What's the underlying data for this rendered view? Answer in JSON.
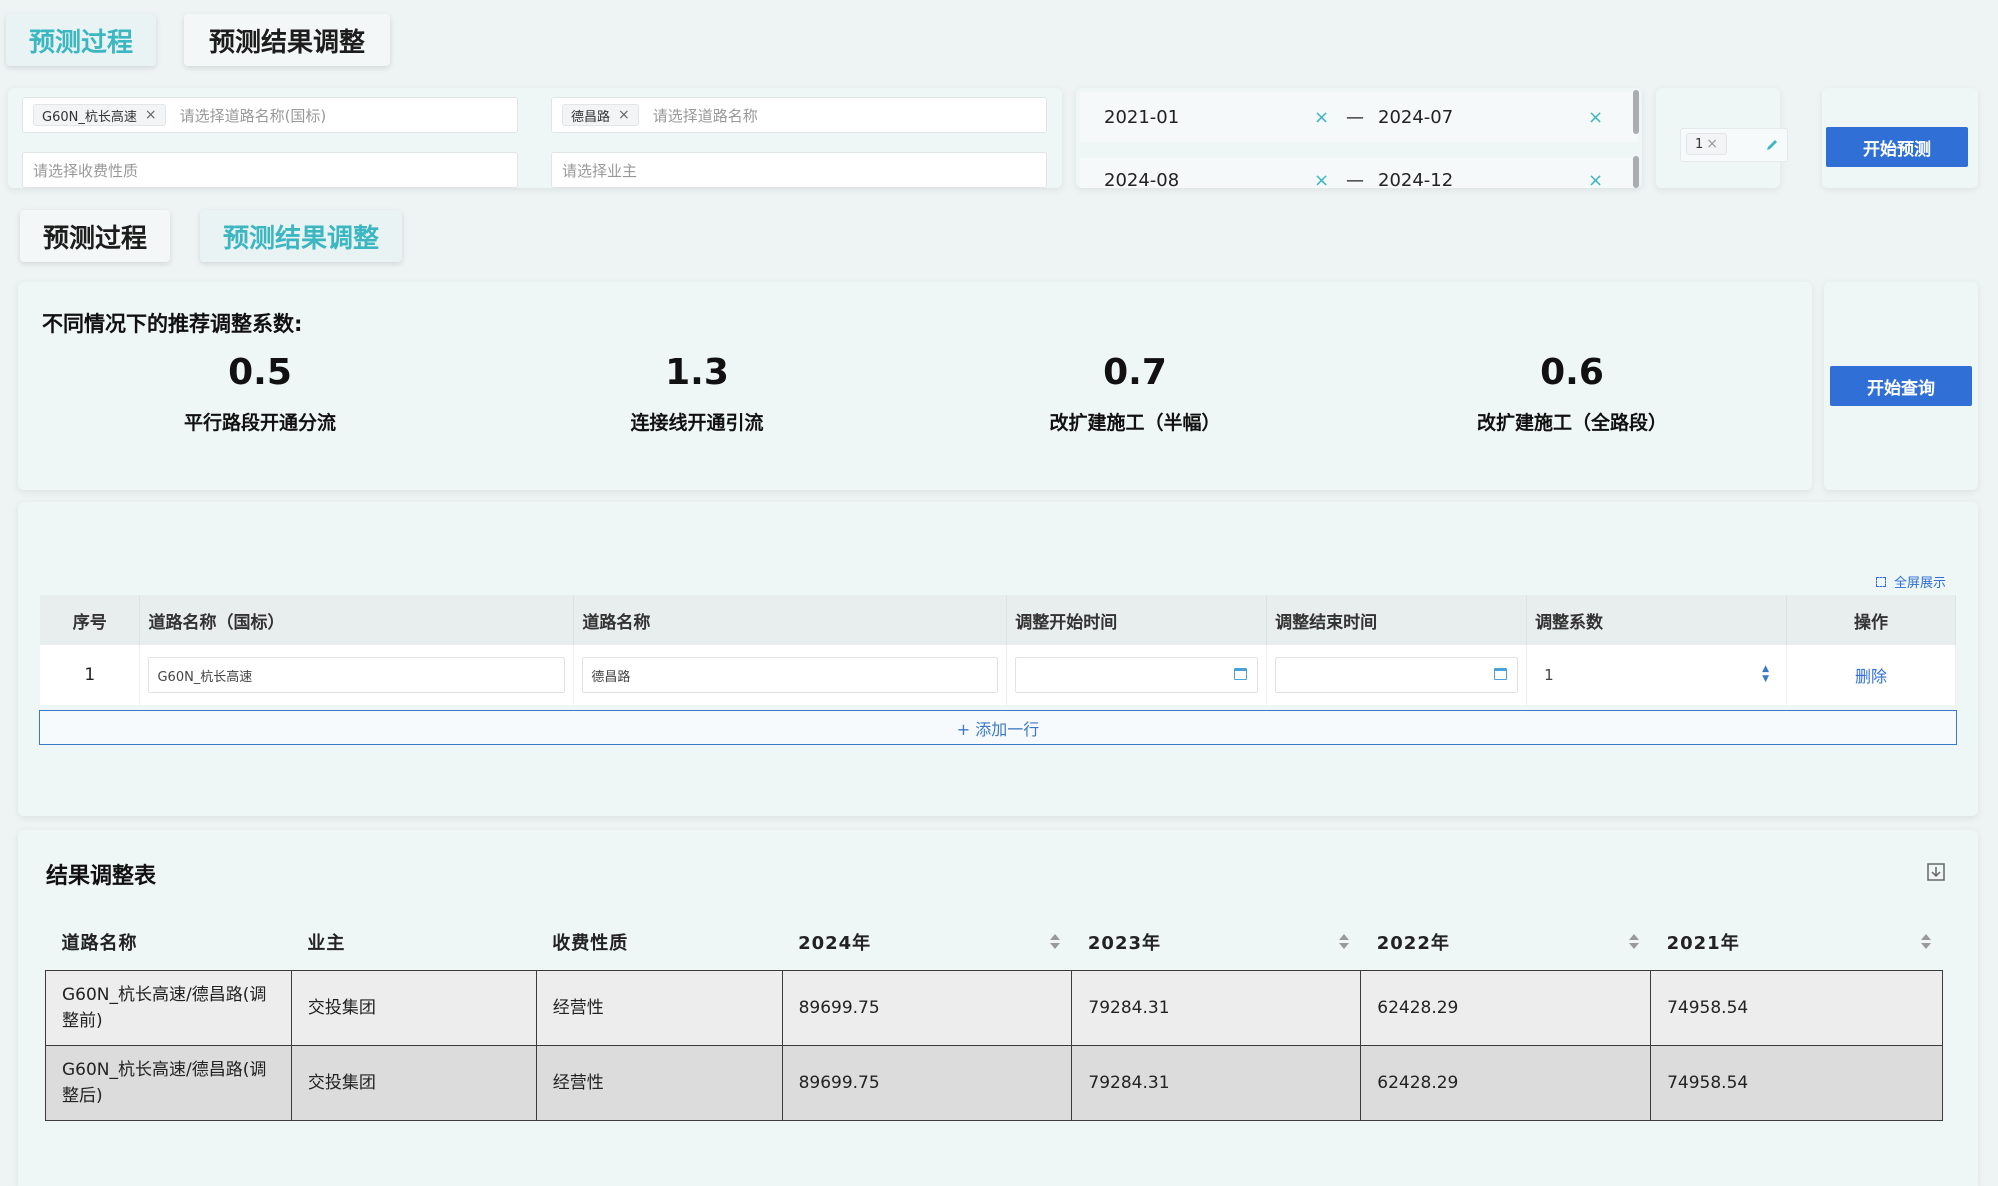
{
  "top_tabs": {
    "process": "预测过程",
    "adjust": "预测结果调整"
  },
  "filters": {
    "road_national_chip": "G60N_杭长高速",
    "road_national_placeholder": "请选择道路名称(国标)",
    "road_name_chip": "德昌路",
    "road_name_placeholder": "请选择道路名称",
    "toll_placeholder": "请选择收费性质",
    "owner_placeholder": "请选择业主",
    "chip_x": "×"
  },
  "date_ranges": [
    {
      "start": "2021-01",
      "end": "2024-07"
    },
    {
      "start": "2024-08",
      "end": "2024-12"
    }
  ],
  "date_sep": "—",
  "date_clear": "×",
  "mini_chip": "1",
  "start_predict": "开始预测",
  "second_tabs": {
    "process": "预测过程",
    "adjust": "预测结果调整"
  },
  "coefficients": {
    "title": "不同情况下的推荐调整系数:",
    "items": [
      {
        "value": "0.5",
        "label": "平行路段开通分流"
      },
      {
        "value": "1.3",
        "label": "连接线开通引流"
      },
      {
        "value": "0.7",
        "label": "改扩建施工（半幅）"
      },
      {
        "value": "0.6",
        "label": "改扩建施工（全路段）"
      }
    ]
  },
  "start_query": "开始查询",
  "fullscreen": "全屏展示",
  "edit_table": {
    "headers": [
      "序号",
      "道路名称（国标）",
      "道路名称",
      "调整开始时间",
      "调整结束时间",
      "调整系数",
      "操作"
    ],
    "row": {
      "index": "1",
      "road_national": "G60N_杭长高速",
      "road_name": "德昌路",
      "start": "",
      "end": "",
      "coef": "1",
      "action": "删除"
    },
    "add_row": "+ 添加一行"
  },
  "result_table": {
    "title": "结果调整表",
    "headers": [
      "道路名称",
      "业主",
      "收费性质",
      "2024年",
      "2023年",
      "2022年",
      "2021年"
    ],
    "rows": [
      [
        "G60N_杭长高速/德昌路(调整前)",
        "交投集团",
        "经营性",
        "89699.75",
        "79284.31",
        "62428.29",
        "74958.54"
      ],
      [
        "G60N_杭长高速/德昌路(调整后)",
        "交投集团",
        "经营性",
        "89699.75",
        "79284.31",
        "62428.29",
        "74958.54"
      ]
    ]
  },
  "colors": {
    "accent": "#3cb7c2",
    "primary_button": "#2f6fd6",
    "link": "#2f6fd6"
  }
}
